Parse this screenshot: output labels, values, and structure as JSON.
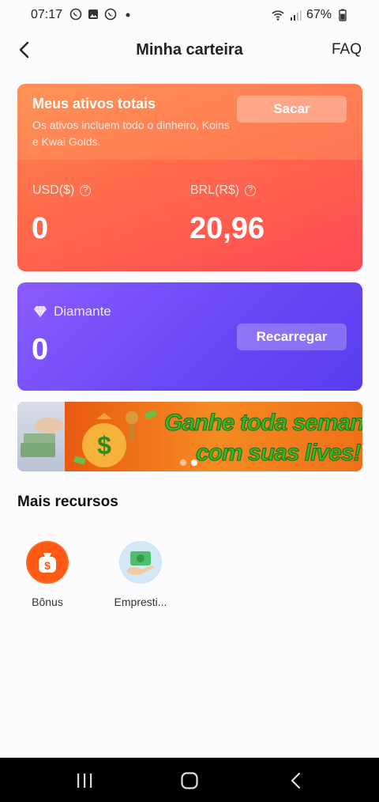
{
  "status_bar": {
    "time": "07:17",
    "battery": "67%"
  },
  "header": {
    "title": "Minha carteira",
    "faq": "FAQ"
  },
  "assets": {
    "title": "Meus ativos totais",
    "description": "Os ativos incluem todo o dinheiro, Koins e Kwai Golds.",
    "withdraw": "Sacar",
    "usd_label": "USD($)",
    "usd_value": "0",
    "brl_label": "BRL(R$)",
    "brl_value": "20,96"
  },
  "diamond": {
    "label": "Diamante",
    "value": "0",
    "recharge": "Recarregar"
  },
  "banner": {
    "line1": "Ganhe toda semana",
    "line2": "com suas lives!"
  },
  "more": {
    "title": "Mais recursos",
    "items": [
      {
        "label": "Bônus",
        "icon": "money-bag-icon"
      },
      {
        "label": "Empresti...",
        "icon": "cash-hand-icon"
      }
    ]
  },
  "colors": {
    "assets_card": "#ff5a4f",
    "diamond_card": "#6a48f5"
  }
}
